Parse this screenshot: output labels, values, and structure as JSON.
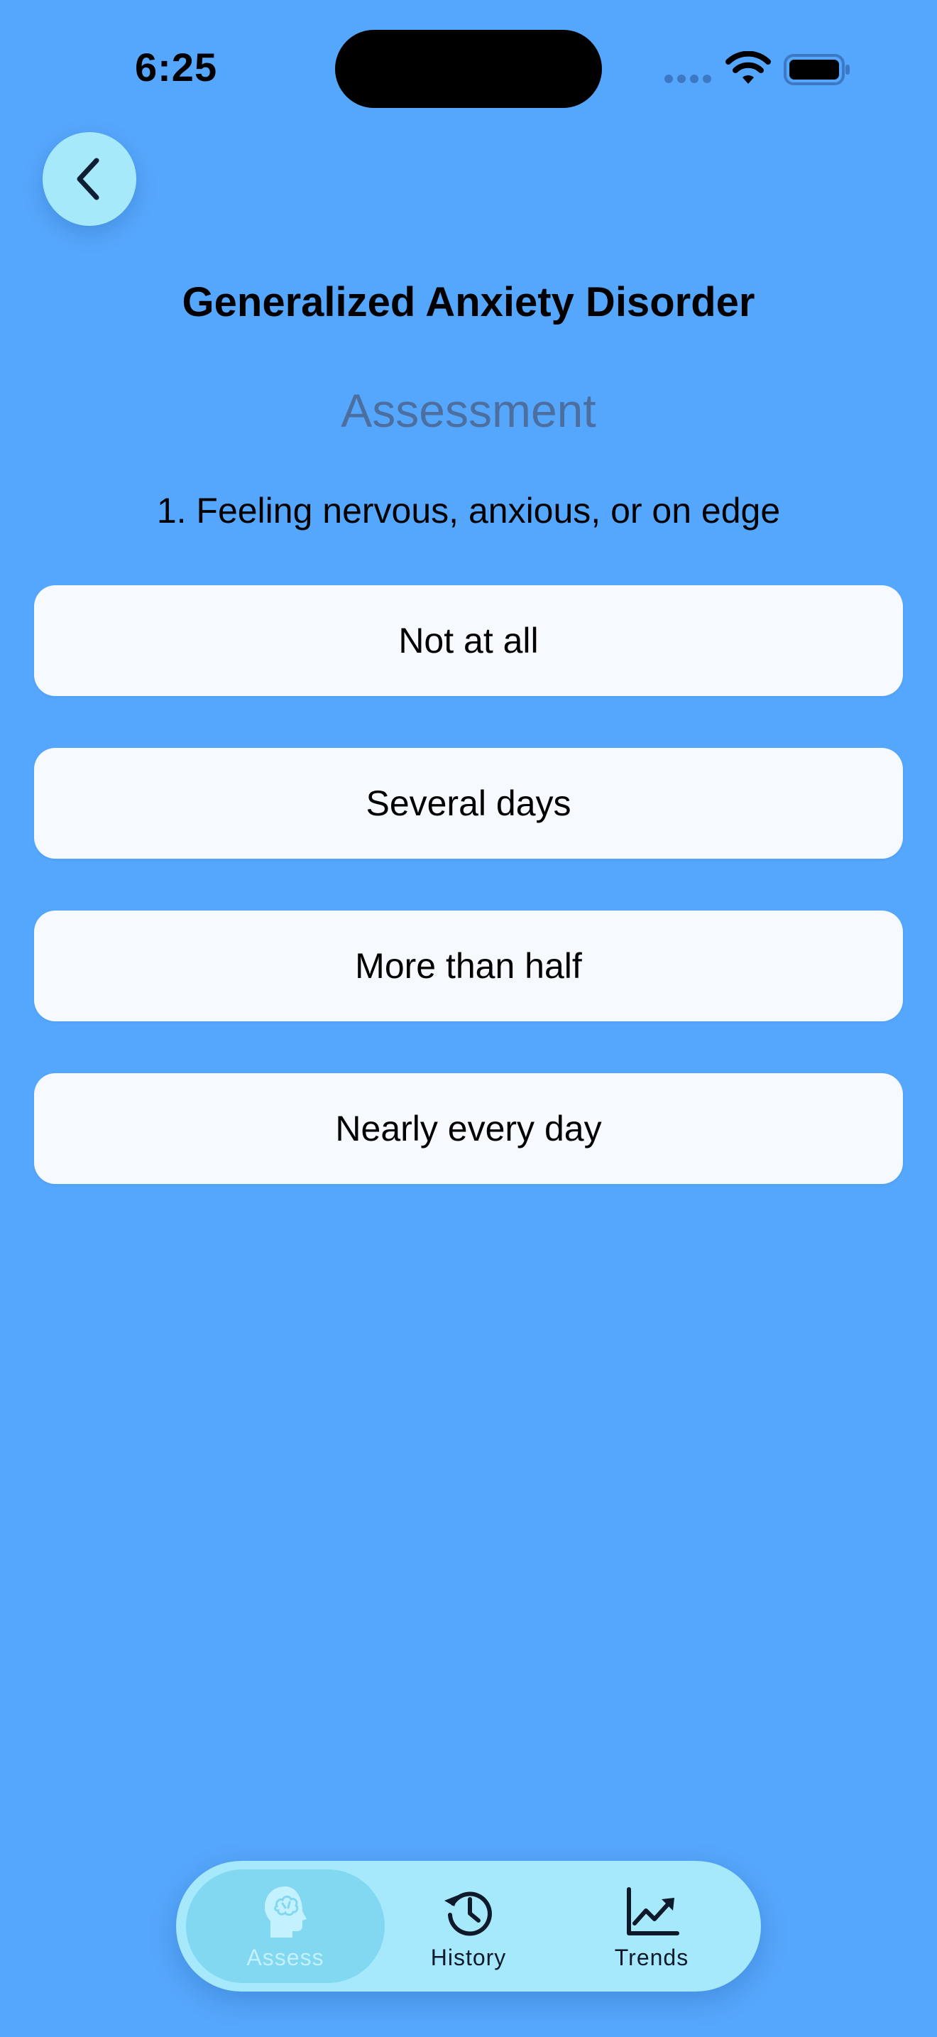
{
  "status_bar": {
    "time": "6:25"
  },
  "header": {
    "back_icon": "chevron-left-icon"
  },
  "main": {
    "title": "Generalized Anxiety Disorder",
    "subtitle": "Assessment",
    "question": "1. Feeling nervous, anxious, or on edge",
    "options": [
      "Not at all",
      "Several days",
      "More than half",
      "Nearly every day"
    ]
  },
  "tabbar": {
    "active": "Assess",
    "tabs": [
      {
        "label": "Assess",
        "icon": "brain-head-icon"
      },
      {
        "label": "History",
        "icon": "history-clock-icon"
      },
      {
        "label": "Trends",
        "icon": "trend-chart-icon"
      }
    ]
  },
  "colors": {
    "background": "#55a7fd",
    "option_bg": "#f6f9fe",
    "accent_light": "#a6e9fd",
    "active_tab": "#82d7f1",
    "subtitle": "#4c6fa0"
  }
}
